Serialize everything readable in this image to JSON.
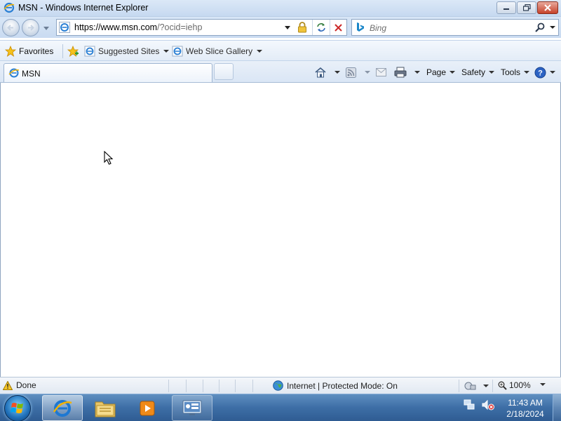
{
  "window": {
    "title": "MSN - Windows Internet Explorer",
    "icon": "ie-icon",
    "controls": [
      "minimize-icon",
      "restore-icon",
      "close-icon"
    ]
  },
  "navigation": {
    "back_icon": "back-arrow-icon",
    "forward_icon": "forward-arrow-icon",
    "address": {
      "scheme": "https://",
      "host": "www.msn.com",
      "path": "/?ocid=iehp",
      "icons": [
        "ie-icon",
        "chevron-down-icon",
        "lock-icon",
        "refresh-icon",
        "stop-icon"
      ]
    },
    "search": {
      "placeholder": "Bing",
      "icons": [
        "bing-icon",
        "search-icon",
        "chevron-down-icon"
      ]
    }
  },
  "favorites_bar": {
    "favorites_label": "Favorites",
    "suggested_sites_label": "Suggested Sites",
    "web_slice_label": "Web Slice Gallery"
  },
  "tabs": [
    {
      "label": "MSN",
      "icon": "ie-icon",
      "active": true
    }
  ],
  "command_bar": {
    "page_label": "Page",
    "safety_label": "Safety",
    "tools_label": "Tools",
    "icons": [
      "home-icon",
      "feeds-icon",
      "mail-icon",
      "print-icon",
      "help-icon"
    ]
  },
  "status_bar": {
    "status_text": "Done",
    "zone_text": "Internet | Protected Mode: On",
    "zoom": "100%"
  },
  "taskbar": {
    "clock_time": "11:43 AM",
    "clock_date": "2/18/2024",
    "pinned": [
      "internet-explorer",
      "windows-explorer",
      "media-player",
      "server-manager"
    ]
  },
  "colors": {
    "chrome": "#c9dbf1",
    "taskbar": "#3d6ea6",
    "close_button": "#c6422a"
  }
}
